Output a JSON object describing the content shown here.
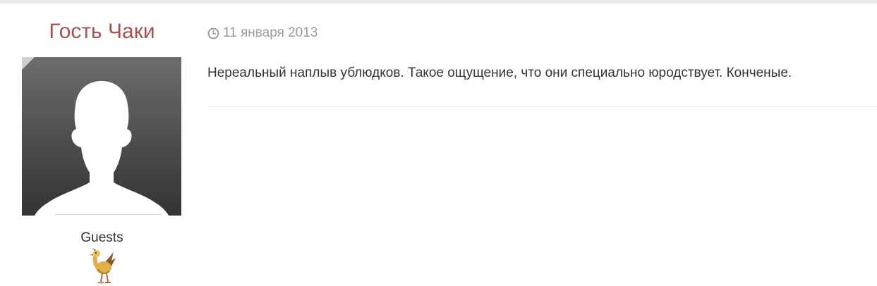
{
  "author": {
    "name": "Гость Чаки",
    "group": "Guests",
    "avatar_icon": "default-user-silhouette-icon",
    "rank_icon": "chocobo-bird-icon"
  },
  "post": {
    "date_icon": "clock-icon",
    "date": "11 января 2013",
    "content": "Нереальный наплыв ублюдков. Такое ощущение, что они специально юродствует. Конченые."
  },
  "colors": {
    "author_name": "#a94f4f",
    "date_text": "#9a9a9a",
    "body_text": "#353535",
    "top_bar": "#e9e9e9"
  }
}
